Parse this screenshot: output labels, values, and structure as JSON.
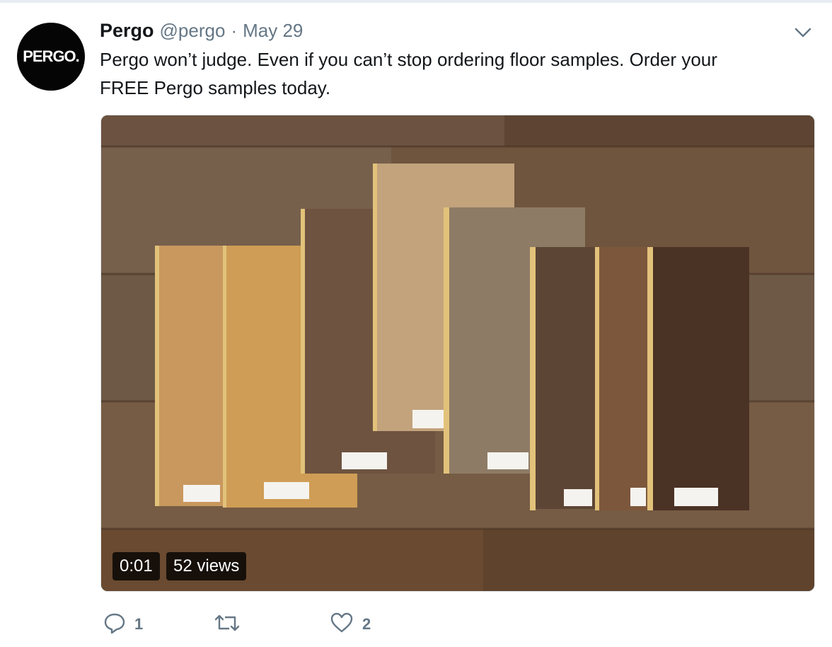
{
  "tweet": {
    "author_name": "Pergo",
    "handle": "@pergo",
    "separator": "·",
    "date": "May 29",
    "avatar_text": "PERGO.",
    "text_line1": "Pergo won’t judge. Even if you can’t stop ordering floor samples. Order your",
    "text_line2": "FREE Pergo samples today."
  },
  "media": {
    "type": "video",
    "description_icon": "wood-floor-samples-video",
    "duration": "0:01",
    "views": "52 views"
  },
  "actions": {
    "reply_icon": "reply-icon",
    "reply_count": "1",
    "retweet_icon": "retweet-icon",
    "retweet_count": "",
    "like_icon": "heart-icon",
    "like_count": "2"
  },
  "colors": {
    "text": "#14171a",
    "secondary": "#657786",
    "divider": "#e6ecf0"
  }
}
